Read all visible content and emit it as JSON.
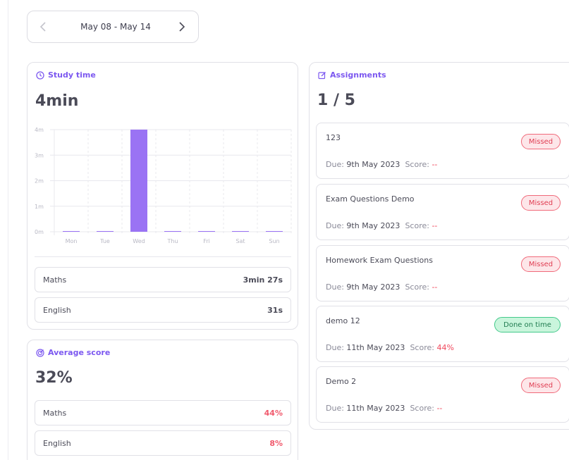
{
  "week": {
    "label": "May 08 - May 14"
  },
  "study_time": {
    "title": "Study time",
    "total": "4min",
    "subjects": [
      {
        "name": "Maths",
        "value": "3min 27s"
      },
      {
        "name": "English",
        "value": "31s"
      }
    ]
  },
  "chart_data": {
    "type": "bar",
    "categories": [
      "Mon",
      "Tue",
      "Wed",
      "Thu",
      "Fri",
      "Sat",
      "Sun"
    ],
    "values": [
      0,
      0,
      4,
      0,
      0,
      0,
      0
    ],
    "y_ticks": [
      "0m",
      "1m",
      "2m",
      "3m",
      "4m"
    ],
    "ylim": [
      0,
      4
    ],
    "title": "",
    "xlabel": "",
    "ylabel": "",
    "bar_color": "#9a73f4",
    "grid": true
  },
  "average_score": {
    "title": "Average score",
    "total": "32%",
    "subjects": [
      {
        "name": "Maths",
        "value": "44%"
      },
      {
        "name": "English",
        "value": "8%"
      }
    ]
  },
  "assignments": {
    "title": "Assignments",
    "total": "1 / 5",
    "items": [
      {
        "title": "123",
        "status": "Missed",
        "due_label": "Due:",
        "due": "9th May 2023",
        "score_label": "Score:",
        "score": "--"
      },
      {
        "title": "Exam Questions Demo",
        "status": "Missed",
        "due_label": "Due:",
        "due": "9th May 2023",
        "score_label": "Score:",
        "score": "--"
      },
      {
        "title": "Homework Exam Questions",
        "status": "Missed",
        "due_label": "Due:",
        "due": "9th May 2023",
        "score_label": "Score:",
        "score": "--"
      },
      {
        "title": "demo 12",
        "status": "Done on time",
        "due_label": "Due:",
        "due": "11th May 2023",
        "score_label": "Score:",
        "score": "44%"
      },
      {
        "title": "Demo 2",
        "status": "Missed",
        "due_label": "Due:",
        "due": "11th May 2023",
        "score_label": "Score:",
        "score": "--"
      }
    ]
  },
  "colors": {
    "accent": "#7c58f0",
    "missed": "#e03d52",
    "done": "#43c98b",
    "score_red": "#f05a6d"
  }
}
